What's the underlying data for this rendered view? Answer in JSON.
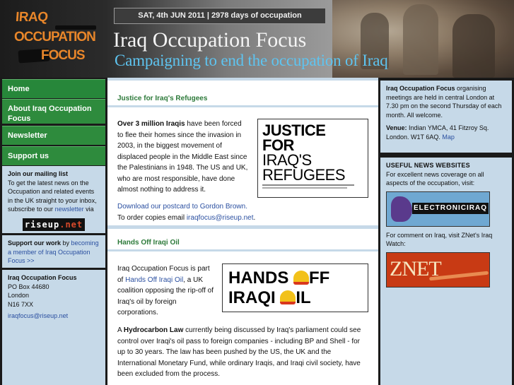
{
  "header": {
    "date_bar": "SAT, 4th JUN 2011 | 2978 days of occupation",
    "logo": {
      "line1": "IRAQ",
      "line2": "OCCUPATION",
      "line3": "FOCUS"
    },
    "title": "Iraq Occupation Focus",
    "tagline": "Campaigning to end the occupation of Iraq"
  },
  "nav": [
    {
      "label": "Home"
    },
    {
      "label": "About Iraq Occupation Focus"
    },
    {
      "label": "Newsletter"
    },
    {
      "label": "Support us"
    }
  ],
  "mailing": {
    "heading": "Join our mailing list",
    "text": "To get the latest news on the Occupation and related events in the UK straight to your inbox, subscribe to our",
    "link": "newsletter",
    "after": "via",
    "riseup_a": "riseup",
    "riseup_b": ".net"
  },
  "support": {
    "lead": "Support our work",
    "pre": "by",
    "link": "becoming a member of Iraq Occupation Focus >>"
  },
  "address": {
    "name": "Iraq Occupation Focus",
    "line1": "PO Box 44680",
    "line2": "London",
    "line3": "N16 7XX",
    "email": "iraqfocus@riseup.net"
  },
  "main": {
    "sec1_title": "Justice for Iraq's Refugees",
    "sec1_bold": "Over 3 million Iraqis",
    "sec1_text": "have been forced to flee their homes since the invasion in 2003, in the biggest movement of displaced people in the Middle East since the Palestinians in 1948. The US and UK, who are most responsible, have done almost nothing to address it.",
    "postcard_link": "Download our postcard to Gordon Brown.",
    "copies_pre": "To order copies email",
    "copies_email": "iraqfocus@riseup.net",
    "copies_post": ".",
    "poster": {
      "l1": "JUSTICE",
      "l2": "FOR",
      "l3": "IRAQ'S",
      "l4": "REFUGEES"
    },
    "sec2_title": "Hands Off Iraqi Oil",
    "sec2_pre": "Iraq Occupation Focus is part of",
    "sec2_link": "Hands Off Iraqi Oil",
    "sec2_post": ", a UK coalition opposing the rip-off of Iraq's oil by foreign corporations.",
    "hoo": {
      "l1a": "HANDS ",
      "l1b": "FF",
      "l2a": "IRAQI ",
      "l2b": "IL"
    },
    "sec3_pre": "A",
    "sec3_bold": "Hydrocarbon Law",
    "sec3_text": "currently being discussed by Iraq's parliament could see control over Iraqi's oil pass to foreign companies - including BP and Shell - for up to 30 years. The law has been pushed by the US, the UK and the International Monetary Fund, while ordinary Iraqis, and Iraqi civil society, have been excluded from the process."
  },
  "right": {
    "meet_bold": "Iraq Occupation Focus",
    "meet_text": "organising meetings are held in central London at 7.30 pm on the second Thursday of each month. All welcome.",
    "venue_bold": "Venue:",
    "venue_text": "Indian YMCA, 41 Fitzroy Sq. London. W1T 6AQ.",
    "venue_link": "Map",
    "news_heading": "USEFUL NEWS WEBSITES",
    "news_text": "For excellent news coverage on all aspects of the occupation, visit:",
    "ei_label": "ELECTRONICIRAQ",
    "znet_text": "For comment on Iraq, visit ZNet's Iraq Watch:",
    "znet_label": "ZNET"
  }
}
